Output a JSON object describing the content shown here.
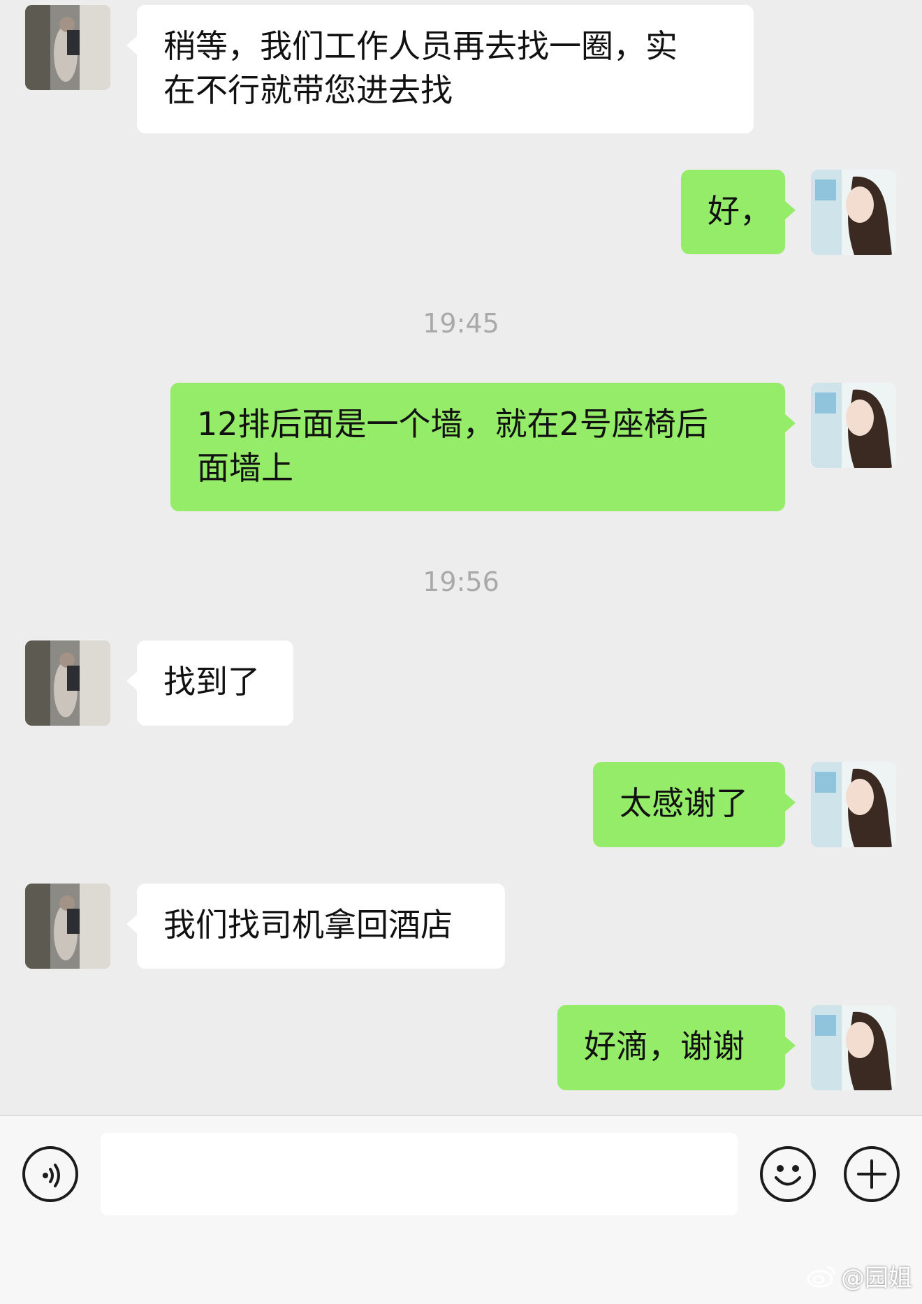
{
  "messages": [
    {
      "side": "in",
      "lines": [
        "稍等，我们工作人员再去找一圈，实",
        "在不行就带您进去找"
      ]
    },
    {
      "side": "out",
      "lines": [
        "好，"
      ]
    },
    {
      "side": "out",
      "lines": [
        "12排后面是一个墙，就在2号座椅后",
        "面墙上"
      ]
    },
    {
      "side": "in",
      "lines": [
        "找到了"
      ]
    },
    {
      "side": "out",
      "lines": [
        "太感谢了"
      ]
    },
    {
      "side": "in",
      "lines": [
        "我们找司机拿回酒店"
      ]
    },
    {
      "side": "out",
      "lines": [
        "好滴，谢谢"
      ]
    }
  ],
  "timestamps": [
    "19:45",
    "19:56"
  ],
  "input_bar": {
    "voice_icon": "voice-icon",
    "text_value": "",
    "emoji_icon": "emoji-icon",
    "plus_icon": "plus-icon"
  },
  "watermark": {
    "icon": "weibo-icon",
    "text": "@园姐"
  },
  "colors": {
    "background": "#ededed",
    "incoming_bubble": "#ffffff",
    "outgoing_bubble": "#95ec69",
    "timestamp": "#a9a9a9"
  }
}
